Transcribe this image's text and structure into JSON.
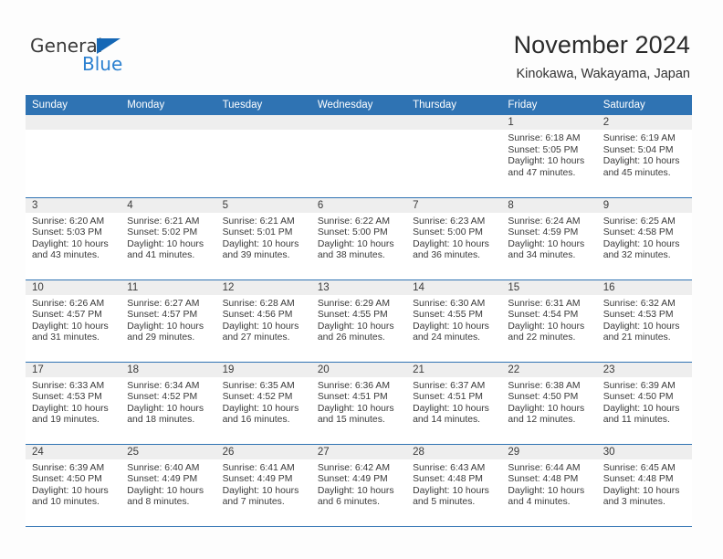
{
  "logo": {
    "text_primary": "General",
    "text_secondary": "Blue",
    "icon": "triangle-icon",
    "color_primary": "#3b3b3b",
    "color_secondary": "#2b80d0",
    "triangle_color": "#1567b5"
  },
  "header": {
    "title": "November 2024",
    "subtitle": "Kinokawa, Wakayama, Japan"
  },
  "theme": {
    "header_blue": "#2f73b3",
    "date_band_gray": "#eeeeee",
    "text_color": "#3a3a3a"
  },
  "calendar": {
    "weekday_headers": [
      "Sunday",
      "Monday",
      "Tuesday",
      "Wednesday",
      "Thursday",
      "Friday",
      "Saturday"
    ],
    "weeks": [
      [
        {
          "date": "",
          "empty": true,
          "lines": []
        },
        {
          "date": "",
          "empty": true,
          "lines": []
        },
        {
          "date": "",
          "empty": true,
          "lines": []
        },
        {
          "date": "",
          "empty": true,
          "lines": []
        },
        {
          "date": "",
          "empty": true,
          "lines": []
        },
        {
          "date": "1",
          "empty": false,
          "lines": [
            "Sunrise: 6:18 AM",
            "Sunset: 5:05 PM",
            "Daylight: 10 hours",
            "and 47 minutes."
          ]
        },
        {
          "date": "2",
          "empty": false,
          "lines": [
            "Sunrise: 6:19 AM",
            "Sunset: 5:04 PM",
            "Daylight: 10 hours",
            "and 45 minutes."
          ]
        }
      ],
      [
        {
          "date": "3",
          "empty": false,
          "lines": [
            "Sunrise: 6:20 AM",
            "Sunset: 5:03 PM",
            "Daylight: 10 hours",
            "and 43 minutes."
          ]
        },
        {
          "date": "4",
          "empty": false,
          "lines": [
            "Sunrise: 6:21 AM",
            "Sunset: 5:02 PM",
            "Daylight: 10 hours",
            "and 41 minutes."
          ]
        },
        {
          "date": "5",
          "empty": false,
          "lines": [
            "Sunrise: 6:21 AM",
            "Sunset: 5:01 PM",
            "Daylight: 10 hours",
            "and 39 minutes."
          ]
        },
        {
          "date": "6",
          "empty": false,
          "lines": [
            "Sunrise: 6:22 AM",
            "Sunset: 5:00 PM",
            "Daylight: 10 hours",
            "and 38 minutes."
          ]
        },
        {
          "date": "7",
          "empty": false,
          "lines": [
            "Sunrise: 6:23 AM",
            "Sunset: 5:00 PM",
            "Daylight: 10 hours",
            "and 36 minutes."
          ]
        },
        {
          "date": "8",
          "empty": false,
          "lines": [
            "Sunrise: 6:24 AM",
            "Sunset: 4:59 PM",
            "Daylight: 10 hours",
            "and 34 minutes."
          ]
        },
        {
          "date": "9",
          "empty": false,
          "lines": [
            "Sunrise: 6:25 AM",
            "Sunset: 4:58 PM",
            "Daylight: 10 hours",
            "and 32 minutes."
          ]
        }
      ],
      [
        {
          "date": "10",
          "empty": false,
          "lines": [
            "Sunrise: 6:26 AM",
            "Sunset: 4:57 PM",
            "Daylight: 10 hours",
            "and 31 minutes."
          ]
        },
        {
          "date": "11",
          "empty": false,
          "lines": [
            "Sunrise: 6:27 AM",
            "Sunset: 4:57 PM",
            "Daylight: 10 hours",
            "and 29 minutes."
          ]
        },
        {
          "date": "12",
          "empty": false,
          "lines": [
            "Sunrise: 6:28 AM",
            "Sunset: 4:56 PM",
            "Daylight: 10 hours",
            "and 27 minutes."
          ]
        },
        {
          "date": "13",
          "empty": false,
          "lines": [
            "Sunrise: 6:29 AM",
            "Sunset: 4:55 PM",
            "Daylight: 10 hours",
            "and 26 minutes."
          ]
        },
        {
          "date": "14",
          "empty": false,
          "lines": [
            "Sunrise: 6:30 AM",
            "Sunset: 4:55 PM",
            "Daylight: 10 hours",
            "and 24 minutes."
          ]
        },
        {
          "date": "15",
          "empty": false,
          "lines": [
            "Sunrise: 6:31 AM",
            "Sunset: 4:54 PM",
            "Daylight: 10 hours",
            "and 22 minutes."
          ]
        },
        {
          "date": "16",
          "empty": false,
          "lines": [
            "Sunrise: 6:32 AM",
            "Sunset: 4:53 PM",
            "Daylight: 10 hours",
            "and 21 minutes."
          ]
        }
      ],
      [
        {
          "date": "17",
          "empty": false,
          "lines": [
            "Sunrise: 6:33 AM",
            "Sunset: 4:53 PM",
            "Daylight: 10 hours",
            "and 19 minutes."
          ]
        },
        {
          "date": "18",
          "empty": false,
          "lines": [
            "Sunrise: 6:34 AM",
            "Sunset: 4:52 PM",
            "Daylight: 10 hours",
            "and 18 minutes."
          ]
        },
        {
          "date": "19",
          "empty": false,
          "lines": [
            "Sunrise: 6:35 AM",
            "Sunset: 4:52 PM",
            "Daylight: 10 hours",
            "and 16 minutes."
          ]
        },
        {
          "date": "20",
          "empty": false,
          "lines": [
            "Sunrise: 6:36 AM",
            "Sunset: 4:51 PM",
            "Daylight: 10 hours",
            "and 15 minutes."
          ]
        },
        {
          "date": "21",
          "empty": false,
          "lines": [
            "Sunrise: 6:37 AM",
            "Sunset: 4:51 PM",
            "Daylight: 10 hours",
            "and 14 minutes."
          ]
        },
        {
          "date": "22",
          "empty": false,
          "lines": [
            "Sunrise: 6:38 AM",
            "Sunset: 4:50 PM",
            "Daylight: 10 hours",
            "and 12 minutes."
          ]
        },
        {
          "date": "23",
          "empty": false,
          "lines": [
            "Sunrise: 6:39 AM",
            "Sunset: 4:50 PM",
            "Daylight: 10 hours",
            "and 11 minutes."
          ]
        }
      ],
      [
        {
          "date": "24",
          "empty": false,
          "lines": [
            "Sunrise: 6:39 AM",
            "Sunset: 4:50 PM",
            "Daylight: 10 hours",
            "and 10 minutes."
          ]
        },
        {
          "date": "25",
          "empty": false,
          "lines": [
            "Sunrise: 6:40 AM",
            "Sunset: 4:49 PM",
            "Daylight: 10 hours",
            "and 8 minutes."
          ]
        },
        {
          "date": "26",
          "empty": false,
          "lines": [
            "Sunrise: 6:41 AM",
            "Sunset: 4:49 PM",
            "Daylight: 10 hours",
            "and 7 minutes."
          ]
        },
        {
          "date": "27",
          "empty": false,
          "lines": [
            "Sunrise: 6:42 AM",
            "Sunset: 4:49 PM",
            "Daylight: 10 hours",
            "and 6 minutes."
          ]
        },
        {
          "date": "28",
          "empty": false,
          "lines": [
            "Sunrise: 6:43 AM",
            "Sunset: 4:48 PM",
            "Daylight: 10 hours",
            "and 5 minutes."
          ]
        },
        {
          "date": "29",
          "empty": false,
          "lines": [
            "Sunrise: 6:44 AM",
            "Sunset: 4:48 PM",
            "Daylight: 10 hours",
            "and 4 minutes."
          ]
        },
        {
          "date": "30",
          "empty": false,
          "lines": [
            "Sunrise: 6:45 AM",
            "Sunset: 4:48 PM",
            "Daylight: 10 hours",
            "and 3 minutes."
          ]
        }
      ]
    ]
  }
}
